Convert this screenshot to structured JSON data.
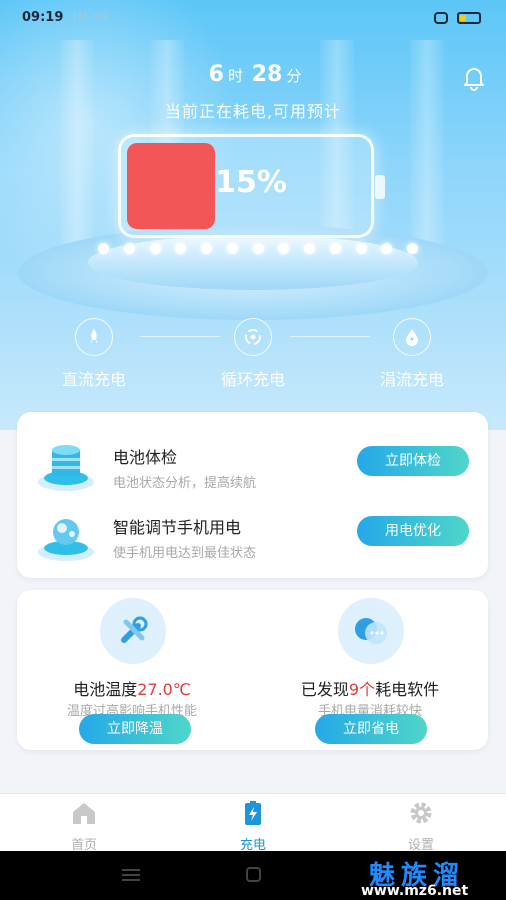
{
  "status_bar": {
    "time": "09:19",
    "signal": "ııl ııl",
    "battery_level": 0.2
  },
  "header": {
    "hours": "6",
    "hours_unit": "时",
    "minutes": "28",
    "minutes_unit": "分",
    "subtitle": "当前正在耗电,可用预计"
  },
  "battery": {
    "percent_label": "15%",
    "level": 0.15,
    "fill_color": "#f25656"
  },
  "modes": [
    {
      "label": "直流充电",
      "icon": "rocket-icon"
    },
    {
      "label": "循环充电",
      "icon": "cycle-icon"
    },
    {
      "label": "涓流充电",
      "icon": "drop-icon"
    }
  ],
  "tools": [
    {
      "title": "电池体检",
      "desc": "电池状态分析，提高续航",
      "button": "立即体检",
      "icon": "battery-stack-icon"
    },
    {
      "title": "智能调节手机用电",
      "desc": "使手机用电达到最佳状态",
      "button": "用电优化",
      "icon": "smart-orb-icon"
    }
  ],
  "stats": [
    {
      "title_prefix": "电池温度",
      "title_highlight": "27.0℃",
      "title_suffix": "",
      "desc": "温度过高影响手机性能",
      "button": "立即降温",
      "icon": "wrench-icon"
    },
    {
      "title_prefix": "已发现",
      "title_highlight": "9个",
      "title_suffix": "耗电软件",
      "desc": "手机电量消耗较快",
      "button": "立即省电",
      "icon": "bubble-icon"
    }
  ],
  "tabs": [
    {
      "label": "首页",
      "icon": "home-icon",
      "active": false
    },
    {
      "label": "充电",
      "icon": "charge-icon",
      "active": true
    },
    {
      "label": "设置",
      "icon": "gear-icon",
      "active": false
    }
  ],
  "watermark": {
    "title": "魅族溜",
    "url": "www.mz6.net"
  },
  "colors": {
    "accent": "#1c96d8",
    "highlight": "#e53b3b",
    "button_start": "#25a8e8",
    "button_end": "#4fd6c9"
  }
}
